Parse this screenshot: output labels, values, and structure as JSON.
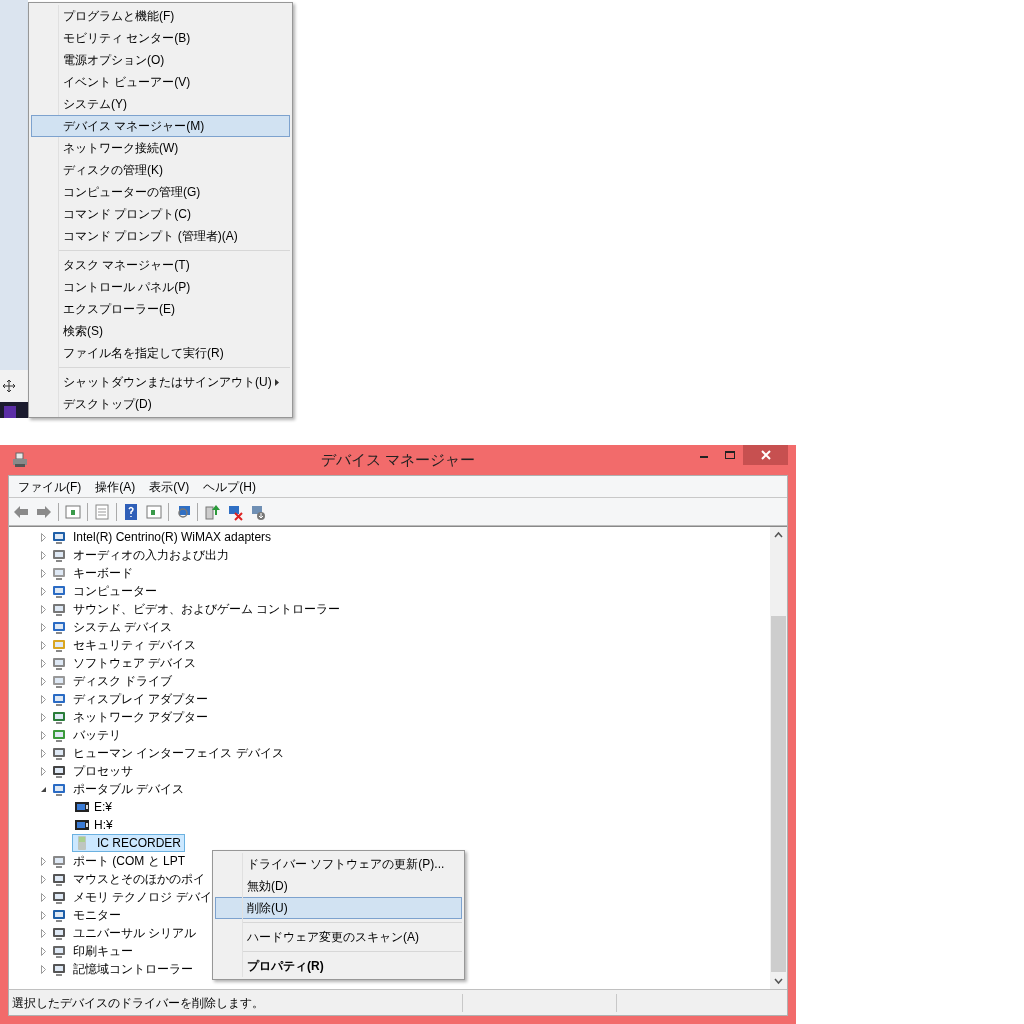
{
  "start_menu": {
    "groups": [
      [
        {
          "label": "プログラムと機能(F)",
          "selected": false,
          "submenu": false
        },
        {
          "label": "モビリティ センター(B)",
          "selected": false,
          "submenu": false
        },
        {
          "label": "電源オプション(O)",
          "selected": false,
          "submenu": false
        },
        {
          "label": "イベント ビューアー(V)",
          "selected": false,
          "submenu": false
        },
        {
          "label": "システム(Y)",
          "selected": false,
          "submenu": false
        },
        {
          "label": "デバイス マネージャー(M)",
          "selected": true,
          "submenu": false
        },
        {
          "label": "ネットワーク接続(W)",
          "selected": false,
          "submenu": false
        },
        {
          "label": "ディスクの管理(K)",
          "selected": false,
          "submenu": false
        },
        {
          "label": "コンピューターの管理(G)",
          "selected": false,
          "submenu": false
        },
        {
          "label": "コマンド プロンプト(C)",
          "selected": false,
          "submenu": false
        },
        {
          "label": "コマンド プロンプト (管理者)(A)",
          "selected": false,
          "submenu": false
        }
      ],
      [
        {
          "label": "タスク マネージャー(T)",
          "selected": false,
          "submenu": false
        },
        {
          "label": "コントロール パネル(P)",
          "selected": false,
          "submenu": false
        },
        {
          "label": "エクスプローラー(E)",
          "selected": false,
          "submenu": false
        },
        {
          "label": "検索(S)",
          "selected": false,
          "submenu": false
        },
        {
          "label": "ファイル名を指定して実行(R)",
          "selected": false,
          "submenu": false
        }
      ],
      [
        {
          "label": "シャットダウンまたはサインアウト(U)",
          "selected": false,
          "submenu": true
        },
        {
          "label": "デスクトップ(D)",
          "selected": false,
          "submenu": false
        }
      ]
    ]
  },
  "window": {
    "title": "デバイス マネージャー",
    "menu": [
      "ファイル(F)",
      "操作(A)",
      "表示(V)",
      "ヘルプ(H)"
    ],
    "tree": [
      {
        "label": "Intel(R) Centrino(R) WiMAX adapters",
        "expanded": false,
        "selected": false
      },
      {
        "label": "オーディオの入力および出力",
        "expanded": false,
        "selected": false
      },
      {
        "label": "キーボード",
        "expanded": false,
        "selected": false
      },
      {
        "label": "コンピューター",
        "expanded": false,
        "selected": false
      },
      {
        "label": "サウンド、ビデオ、およびゲーム コントローラー",
        "expanded": false,
        "selected": false
      },
      {
        "label": "システム デバイス",
        "expanded": false,
        "selected": false
      },
      {
        "label": "セキュリティ デバイス",
        "expanded": false,
        "selected": false
      },
      {
        "label": "ソフトウェア デバイス",
        "expanded": false,
        "selected": false
      },
      {
        "label": "ディスク ドライブ",
        "expanded": false,
        "selected": false
      },
      {
        "label": "ディスプレイ アダプター",
        "expanded": false,
        "selected": false
      },
      {
        "label": "ネットワーク アダプター",
        "expanded": false,
        "selected": false
      },
      {
        "label": "バッテリ",
        "expanded": false,
        "selected": false
      },
      {
        "label": "ヒューマン インターフェイス デバイス",
        "expanded": false,
        "selected": false
      },
      {
        "label": "プロセッサ",
        "expanded": false,
        "selected": false
      },
      {
        "label": "ポータブル デバイス",
        "expanded": true,
        "selected": false,
        "children": [
          {
            "label": "E:¥",
            "selected": false
          },
          {
            "label": "H:¥",
            "selected": false
          },
          {
            "label": "IC RECORDER",
            "selected": true
          }
        ]
      },
      {
        "label": "ポート (COM と LPT",
        "expanded": false,
        "selected": false
      },
      {
        "label": "マウスとそのほかのポイ",
        "expanded": false,
        "selected": false
      },
      {
        "label": "メモリ テクノロジ デバイ",
        "expanded": false,
        "selected": false
      },
      {
        "label": "モニター",
        "expanded": false,
        "selected": false
      },
      {
        "label": "ユニバーサル シリアル",
        "expanded": false,
        "selected": false
      },
      {
        "label": "印刷キュー",
        "expanded": false,
        "selected": false
      },
      {
        "label": "記憶域コントローラー",
        "expanded": false,
        "selected": false
      }
    ],
    "context_menu": {
      "groups": [
        [
          {
            "label": "ドライバー ソフトウェアの更新(P)...",
            "selected": false,
            "default": false
          },
          {
            "label": "無効(D)",
            "selected": false,
            "default": false
          },
          {
            "label": "削除(U)",
            "selected": true,
            "default": false
          }
        ],
        [
          {
            "label": "ハードウェア変更のスキャン(A)",
            "selected": false,
            "default": false
          }
        ],
        [
          {
            "label": "プロパティ(R)",
            "selected": false,
            "default": true
          }
        ]
      ]
    },
    "status_bar": {
      "text": "選択したデバイスのドライバーを削除します。"
    }
  }
}
